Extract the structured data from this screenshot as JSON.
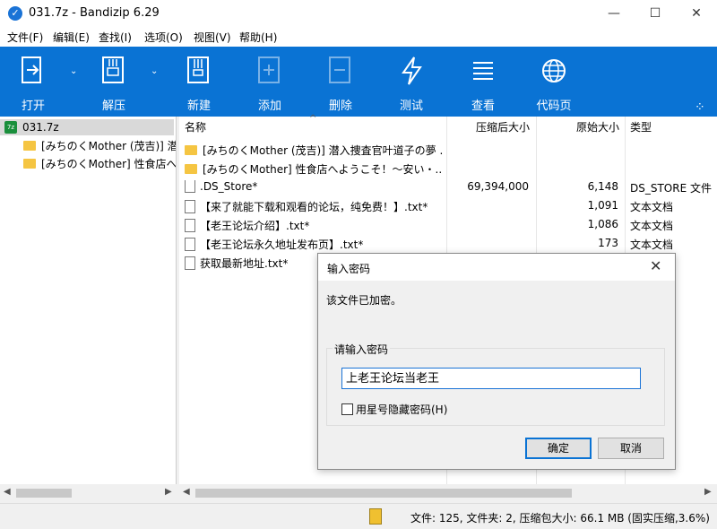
{
  "window": {
    "title": "031.7z - Bandizip 6.29"
  },
  "menu": [
    "文件(F)",
    "编辑(E)",
    "查找(I)",
    "选项(O)",
    "视图(V)",
    "帮助(H)"
  ],
  "toolbar": [
    {
      "label": "打开",
      "icon": "open-icon",
      "dropdown": true
    },
    {
      "label": "解压",
      "icon": "extract-icon",
      "dropdown": true
    },
    {
      "label": "新建",
      "icon": "new-archive-icon"
    },
    {
      "label": "添加",
      "icon": "add-icon"
    },
    {
      "label": "删除",
      "icon": "delete-icon"
    },
    {
      "label": "测试",
      "icon": "test-icon"
    },
    {
      "label": "查看",
      "icon": "view-icon"
    },
    {
      "label": "代码页",
      "icon": "codepage-icon"
    }
  ],
  "tree": {
    "root": "031.7z",
    "items": [
      "[みちのくMother (茂吉)] 潜",
      "[みちのくMother] 性食店へ"
    ]
  },
  "columns": {
    "name": "名称",
    "compressed": "压缩后大小",
    "original": "原始大小",
    "type": "类型"
  },
  "files": [
    {
      "name": "[みちのくMother (茂吉)] 潜入捜査官叶道子の夢 ...",
      "kind": "folder",
      "compressed": "",
      "original": "",
      "type": ""
    },
    {
      "name": "[みちのくMother] 性食店へようこそ！〜安い・...",
      "kind": "folder",
      "compressed": "",
      "original": "",
      "type": ""
    },
    {
      "name": ".DS_Store*",
      "kind": "file",
      "compressed": "69,394,000",
      "original": "6,148",
      "type": "DS_STORE 文件"
    },
    {
      "name": "【来了就能下载和观看的论坛，纯免费！】.txt*",
      "kind": "file",
      "compressed": "",
      "original": "1,091",
      "type": "文本文档"
    },
    {
      "name": "【老王论坛介绍】.txt*",
      "kind": "file",
      "compressed": "",
      "original": "1,086",
      "type": "文本文档"
    },
    {
      "name": "【老王论坛永久地址发布页】.txt*",
      "kind": "file",
      "compressed": "",
      "original": "173",
      "type": "文本文档"
    },
    {
      "name": "获取最新地址.txt*",
      "kind": "file",
      "compressed": "",
      "original": "",
      "type": ""
    }
  ],
  "status": {
    "text": "文件: 125, 文件夹: 2, 压缩包大小: 66.1 MB (固实压缩,3.6%)"
  },
  "dialog": {
    "title": "输入密码",
    "message": "该文件已加密。",
    "group_label": "请输入密码",
    "password_value": "上老王论坛当老王",
    "checkbox_label": "用星号隐藏密码(H)",
    "ok": "确定",
    "cancel": "取消"
  },
  "colors": {
    "toolbar": "#0a73d4",
    "accent": "#1a73d6",
    "folder": "#f5c542"
  }
}
